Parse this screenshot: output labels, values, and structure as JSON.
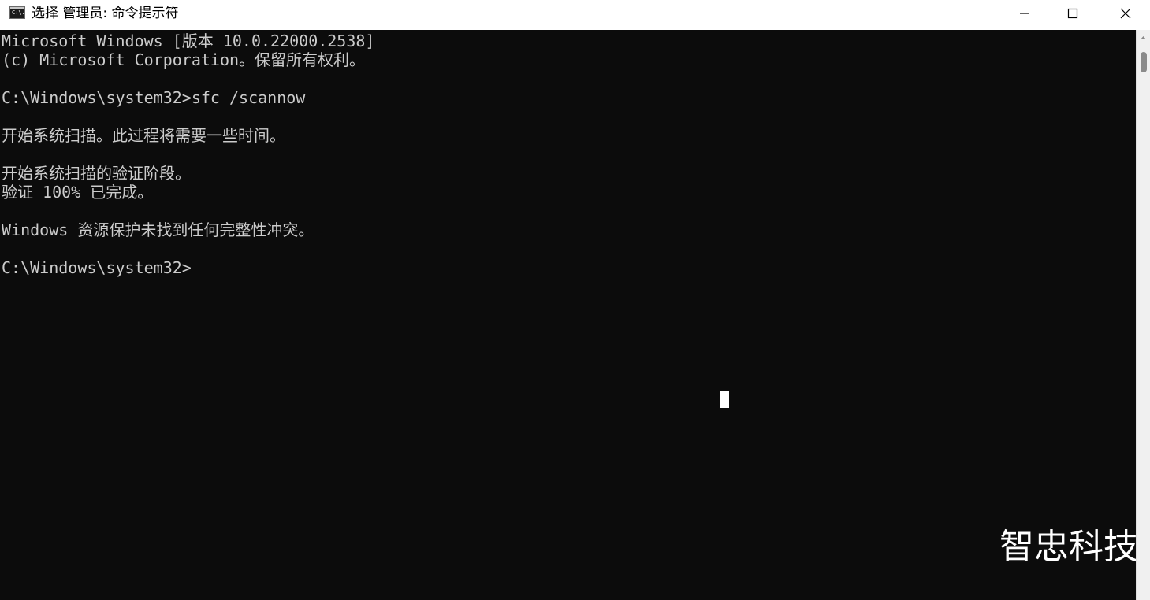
{
  "window": {
    "title": "选择 管理员: 命令提示符",
    "app_icon": "cmd-icon",
    "app_icon_text": "C:\\."
  },
  "controls": {
    "minimize_icon": "minimize-icon",
    "maximize_icon": "maximize-icon",
    "close_icon": "close-icon"
  },
  "console": {
    "lines": [
      "Microsoft Windows [版本 10.0.22000.2538]",
      "(c) Microsoft Corporation。保留所有权利。",
      "",
      "C:\\Windows\\system32>sfc /scannow",
      "",
      "开始系统扫描。此过程将需要一些时间。",
      "",
      "开始系统扫描的验证阶段。",
      "验证 100% 已完成。",
      "",
      "Windows 资源保护未找到任何完整性冲突。",
      "",
      "C:\\Windows\\system32>"
    ],
    "text_color": "#cccccc",
    "background_color": "#0c0c0c"
  },
  "watermark": {
    "text": "智忠科技"
  }
}
